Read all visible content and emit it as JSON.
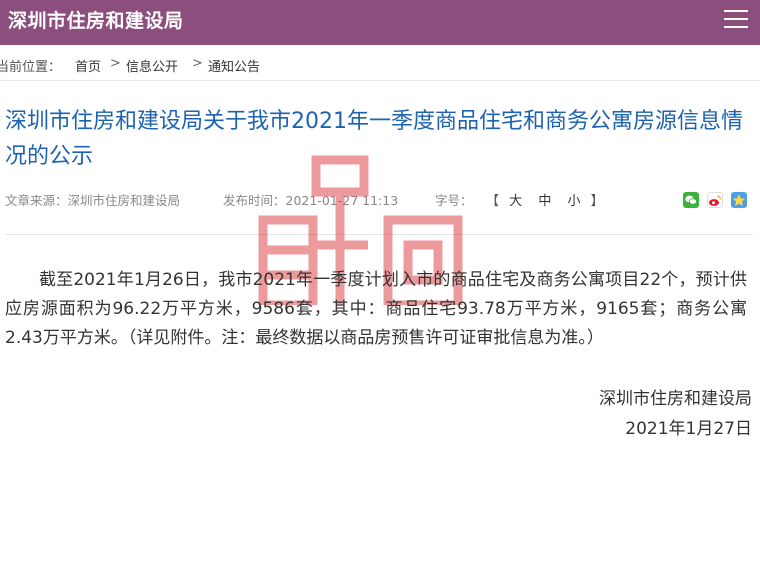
{
  "header": {
    "site_title": "深圳市住房和建设局",
    "menu_icon": "hamburger-menu-icon"
  },
  "breadcrumb": {
    "label": "当前位置：",
    "items": [
      "首页",
      "信息公开",
      "通知公告"
    ],
    "separator": ">"
  },
  "article": {
    "title": "深圳市住房和建设局关于我市2021年一季度商品住宅和商务公寓房源信息情况的公示",
    "meta": {
      "source": "文章来源：深圳市住房和建设局",
      "publish_time": "发布时间：2021-01-27 11:13",
      "font_size_label": "字号：",
      "font_sizes": [
        "大",
        "中",
        "小"
      ],
      "bracket_open": "【",
      "bracket_close": "】"
    },
    "body": "截至2021年1月26日，我市2021年一季度计划入市的商品住宅及商务公寓项目22个，预计供应房源面积为96.22万平方米，9586套，其中：商品住宅93.78万平方米，9165套；商务公寓2.43万平方米。（详见附件。注：最终数据以商品房预售许可证审批信息为准。）",
    "signature": {
      "org": "深圳市住房和建设局",
      "date": "2021年1月27日"
    }
  },
  "share_icons": [
    "wechat-icon",
    "weibo-icon",
    "qzone-icon"
  ],
  "colors": {
    "header_bg": "#8c4e7c",
    "title_blue": "#1d63b0",
    "watermark_red": "#e0484c"
  }
}
